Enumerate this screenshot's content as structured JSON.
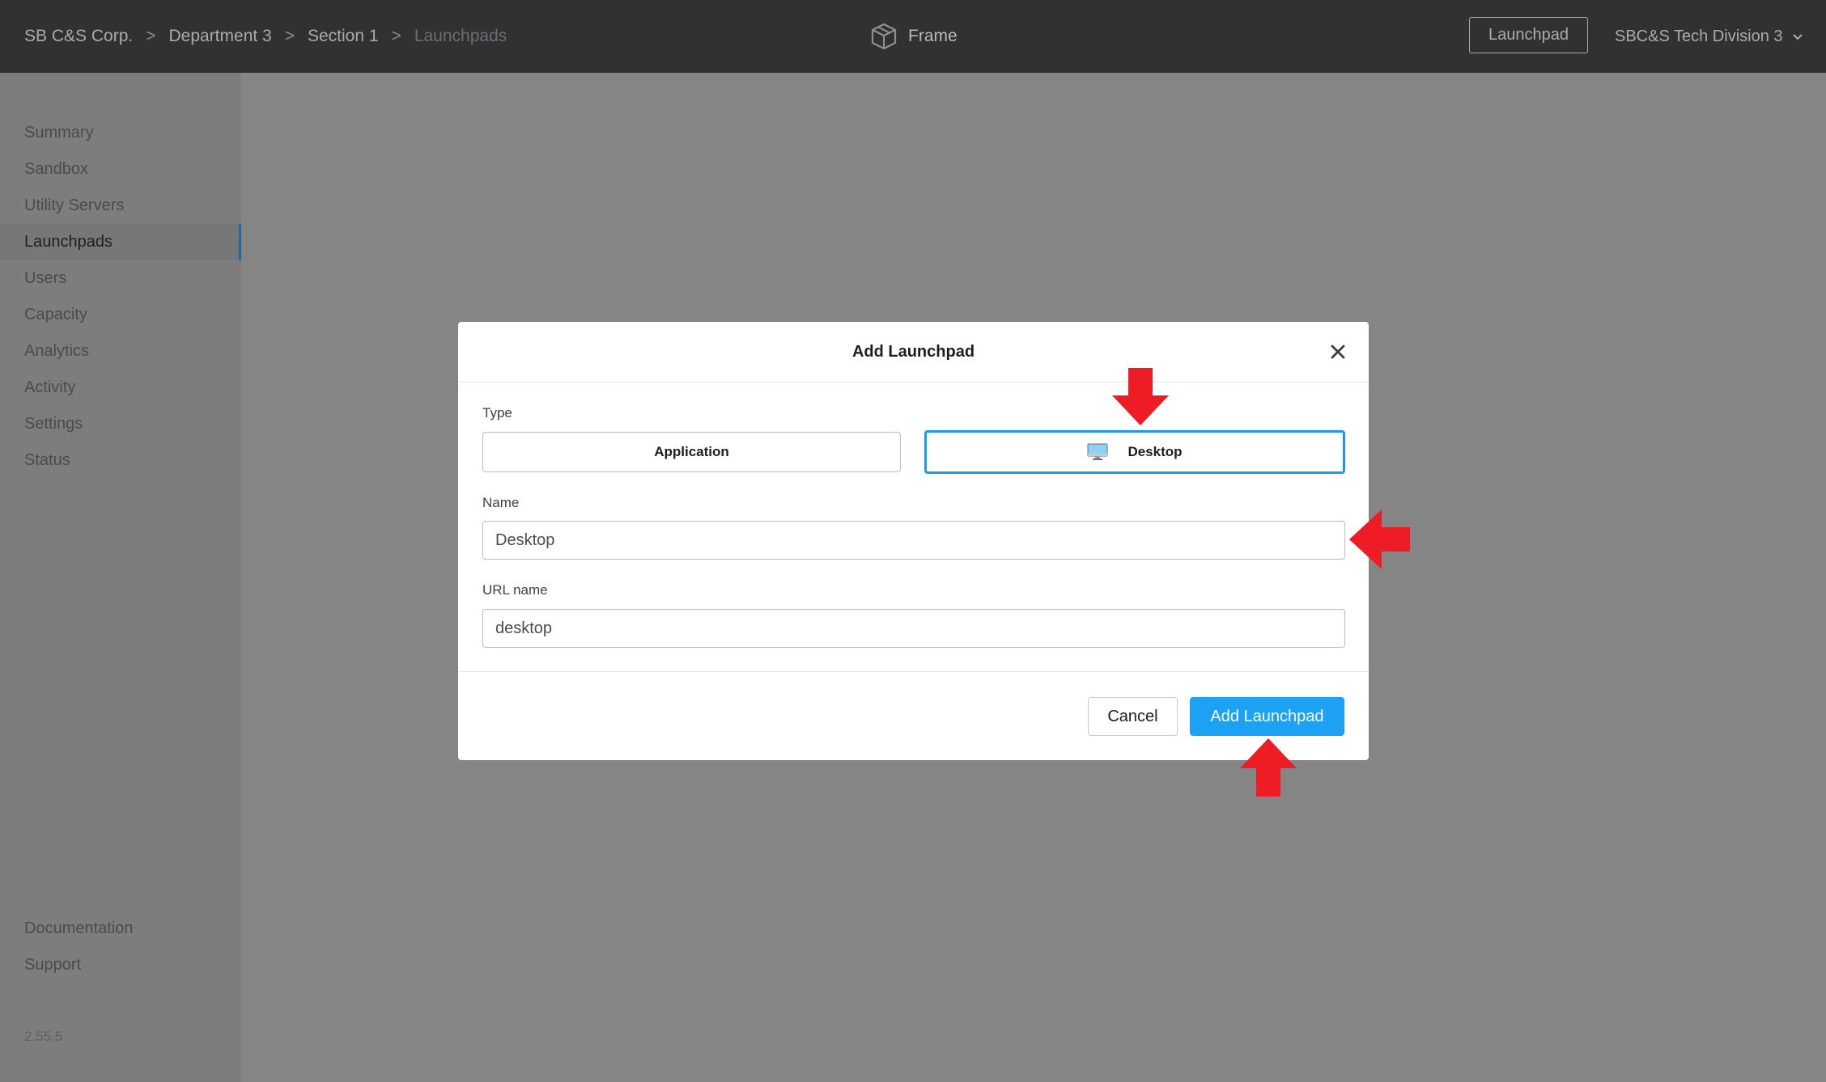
{
  "header": {
    "breadcrumbs": [
      "SB C&S Corp.",
      "Department 3",
      "Section 1",
      "Launchpads"
    ],
    "separator": ">",
    "brand": "Frame",
    "launchpad_button": "Launchpad",
    "account": "SBC&S Tech Division 3"
  },
  "sidebar": {
    "items": [
      {
        "label": "Summary"
      },
      {
        "label": "Sandbox"
      },
      {
        "label": "Utility Servers"
      },
      {
        "label": "Launchpads",
        "active": true
      },
      {
        "label": "Users"
      },
      {
        "label": "Capacity"
      },
      {
        "label": "Analytics"
      },
      {
        "label": "Activity"
      },
      {
        "label": "Settings"
      },
      {
        "label": "Status"
      }
    ],
    "bottom_items": [
      {
        "label": "Documentation"
      },
      {
        "label": "Support"
      }
    ],
    "version": "2.55.5"
  },
  "modal": {
    "title": "Add Launchpad",
    "type_label": "Type",
    "type_options": [
      "Application",
      "Desktop"
    ],
    "selected_type": "Desktop",
    "name_label": "Name",
    "name_value": "Desktop",
    "url_label": "URL name",
    "url_value": "desktop",
    "cancel_label": "Cancel",
    "submit_label": "Add Launchpad"
  },
  "colors": {
    "accent": "#1da1f2",
    "annotation_arrow": "#ee1c25",
    "topbar": "#2f3133"
  },
  "icons": {
    "brand": "cube-icon",
    "account_menu": "chevron-down-icon",
    "close": "close-icon",
    "desktop": "monitor-icon"
  }
}
